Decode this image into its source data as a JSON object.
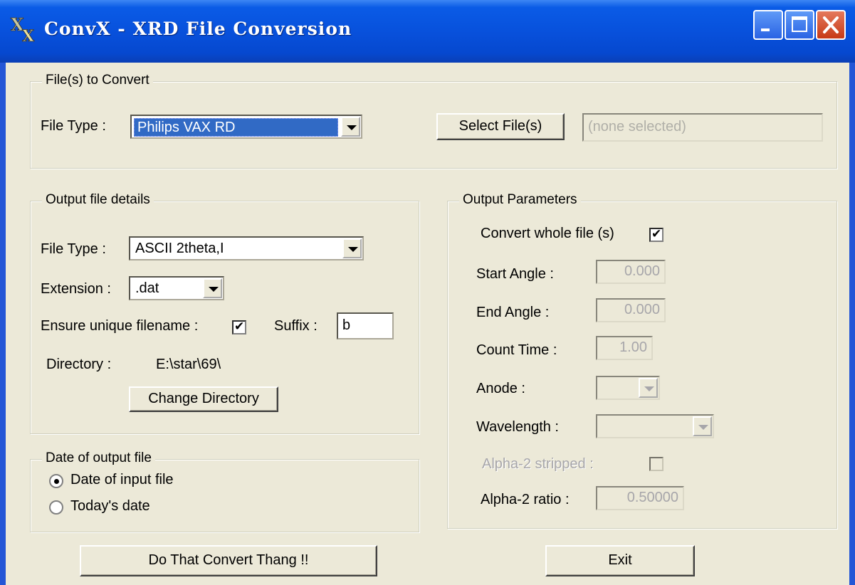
{
  "window": {
    "title": "ConvX  -  XRD File Conversion"
  },
  "files_group": {
    "legend": "File(s) to Convert",
    "file_type_label": "File Type :",
    "file_type_value": "Philips VAX RD",
    "select_button": "Select File(s)",
    "selection_text": "(none selected)"
  },
  "output_group": {
    "legend": "Output file details",
    "file_type_label": "File Type :",
    "file_type_value": "ASCII 2theta,I",
    "extension_label": "Extension :",
    "extension_value": ".dat",
    "unique_label": "Ensure unique filename :",
    "unique_checked": true,
    "suffix_label": "Suffix :",
    "suffix_value": "b",
    "directory_label": "Directory :",
    "directory_value": "E:\\star\\69\\",
    "change_dir_button": "Change Directory"
  },
  "date_group": {
    "legend": "Date of output file",
    "option_input": "Date of input file",
    "option_today": "Today's date",
    "selected": "input"
  },
  "params_group": {
    "legend": "Output Parameters",
    "convert_whole_label": "Convert whole file (s)",
    "convert_whole_checked": true,
    "start_angle_label": "Start Angle :",
    "start_angle_value": "0.000",
    "end_angle_label": "End Angle :",
    "end_angle_value": "0.000",
    "count_time_label": "Count  Time :",
    "count_time_value": "1.00",
    "anode_label": "Anode :",
    "anode_value": "",
    "wavelength_label": "Wavelength :",
    "wavelength_value": "",
    "alpha2_stripped_label": "Alpha-2 stripped :",
    "alpha2_stripped_checked": false,
    "alpha2_ratio_label": "Alpha-2 ratio :",
    "alpha2_ratio_value": "0.50000"
  },
  "actions": {
    "convert_button": "Do That Convert Thang !!",
    "exit_button": "Exit"
  },
  "colors": {
    "titlebar": "#0851dc",
    "face": "#ece9d8",
    "selection": "#316ac5"
  }
}
